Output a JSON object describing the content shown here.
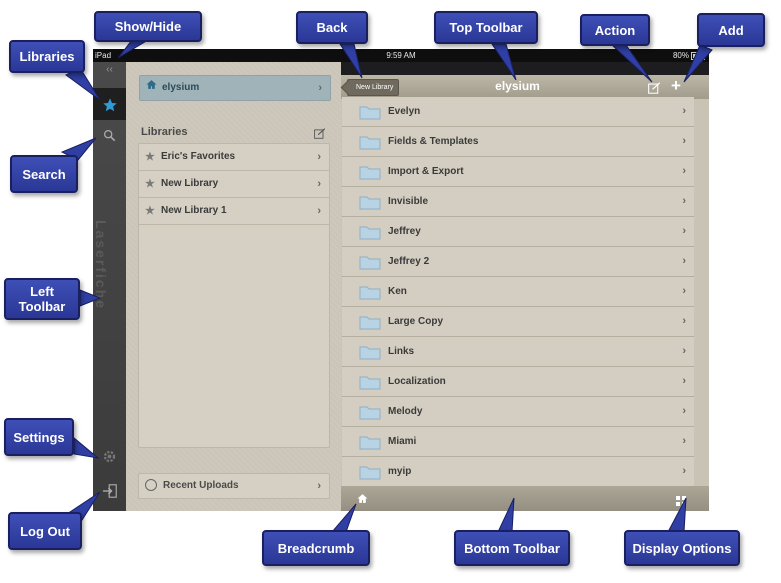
{
  "status_bar": {
    "device": "iPad",
    "time": "9:59 AM",
    "battery": "80%"
  },
  "left_toolbar": {
    "brand": "Laserfiche"
  },
  "libraries_panel": {
    "current_repository": "elysium",
    "heading": "Libraries",
    "items": [
      {
        "label": "Eric's Favorites"
      },
      {
        "label": "New Library"
      },
      {
        "label": "New Library 1"
      }
    ],
    "recent_uploads": "Recent Uploads"
  },
  "top_toolbar": {
    "back_label": "New Library",
    "title": "elysium"
  },
  "folders": [
    {
      "name": "Evelyn"
    },
    {
      "name": "Fields & Templates"
    },
    {
      "name": "Import & Export"
    },
    {
      "name": "Invisible"
    },
    {
      "name": "Jeffrey"
    },
    {
      "name": "Jeffrey 2"
    },
    {
      "name": "Ken"
    },
    {
      "name": "Large Copy"
    },
    {
      "name": "Links"
    },
    {
      "name": "Localization"
    },
    {
      "name": "Melody"
    },
    {
      "name": "Miami"
    },
    {
      "name": "myip"
    }
  ],
  "callouts": {
    "show_hide": "Show/Hide",
    "libraries": "Libraries",
    "search": "Search",
    "left_toolbar": "Left Toolbar",
    "settings": "Settings",
    "log_out": "Log Out",
    "back": "Back",
    "top_toolbar": "Top Toolbar",
    "action": "Action",
    "add": "Add",
    "breadcrumb": "Breadcrumb",
    "bottom_toolbar": "Bottom Toolbar",
    "display_options": "Display Options"
  },
  "colors": {
    "callout_fill": "#3346a8",
    "accent_star": "#2e9bd6",
    "panel_bg": "#cdc8bb",
    "folder_icon": "#b8d4e4"
  }
}
